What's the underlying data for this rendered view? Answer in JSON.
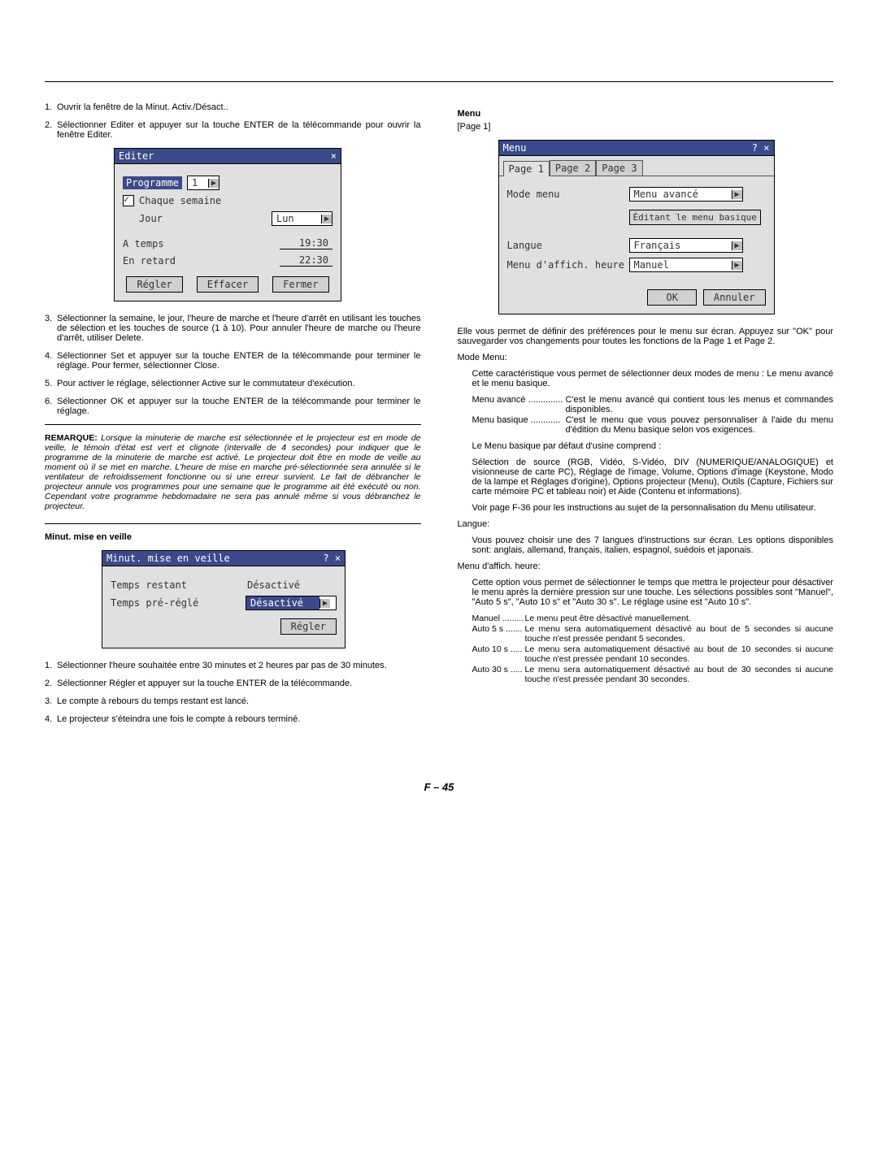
{
  "left": {
    "step1": "Ouvrir la fenêtre de la Minut. Activ./Désact..",
    "step2": "Sélectionner Editer et appuyer sur la touche ENTER de la télécommande pour ouvrir la fenêtre Editer.",
    "editer": {
      "title": "Editer",
      "prog_label": "Programme",
      "prog_val": "1",
      "chaque": "Chaque semaine",
      "jour_label": "Jour",
      "jour_val": "Lun",
      "atemps_label": "A temps",
      "atemps_val": "19:30",
      "retard_label": "En retard",
      "retard_val": "22:30",
      "regler": "Régler",
      "effacer": "Effacer",
      "fermer": "Fermer"
    },
    "step3": "Sélectionner la semaine, le jour, l'heure de marche et l'heure d'arrêt en utilisant les touches de sélection et les touches de source (1 à 10). Pour annuler l'heure de marche ou l'heure d'arrêt, utiliser Delete.",
    "step4": "Sélectionner Set et appuyer sur la touche ENTER de la télécommande pour terminer le réglage. Pour fermer, sélectionner Close.",
    "step5": "Pour activer le réglage, sélectionner Active sur le commutateur d'exécution.",
    "step6": "Sélectionner OK et appuyer sur la touche ENTER de la télécommande pour terminer le réglage.",
    "remark_label": "REMARQUE:",
    "remark": "Lorsque la minuterie de marche est sélectionnée et le projecteur est en mode de veille, le témoin d'état est vert et clignote (intervalle de 4 secondes) pour indiquer que le programme de la minuterie de marche est activé. Le projecteur doit être en mode de veille au moment où il se met en marche. L'heure de mise en marche pré-sélectionnée sera annulée si le ventilateur de refroidissement fonctionne ou si une erreur survient. Le fait de débrancher le projecteur annule vos programmes pour une semaine que le programme ait été exécuté ou non. Cependant votre programme hebdomadaire ne sera pas annulé même si vous débranchez le projecteur.",
    "minut_heading": "Minut. mise en veille",
    "minut": {
      "title": "Minut. mise en veille",
      "temps_restant_label": "Temps restant",
      "temps_restant_val": "Désactivé",
      "preregle_label": "Temps pré-réglé",
      "preregle_val": "Désactivé",
      "regler": "Régler"
    },
    "m1": "Sélectionner l'heure souhaitée entre 30 minutes et 2 heures par pas de 30 minutes.",
    "m2": "Sélectionner Régler et appuyer sur la touche ENTER de la télécommande.",
    "m3": "Le compte à rebours du temps restant est lancé.",
    "m4": "Le projecteur s'éteindra une fois le compte à rebours terminé."
  },
  "right": {
    "menu_heading": "Menu",
    "page1": "[Page 1]",
    "menu": {
      "title": "Menu",
      "tab1": "Page 1",
      "tab2": "Page 2",
      "tab3": "Page 3",
      "mode_label": "Mode menu",
      "mode_val": "Menu avancé",
      "edit_btn": "Éditant le menu basique",
      "langue_label": "Langue",
      "langue_val": "Français",
      "affich_label": "Menu d'affich. heure",
      "affich_val": "Manuel",
      "ok": "OK",
      "annuler": "Annuler"
    },
    "p1": "Elle vous permet de définir des préférences pour le menu sur écran. Appuyez sur \"OK\" pour sauvegarder vos changements pour toutes les fonctions de la Page 1 et Page 2.",
    "mode_heading": "Mode Menu:",
    "mode_desc": "Cette caractéristique vous permet de sélectionner deux modes de menu : Le menu avancé et le menu basique.",
    "def_avance_t": "Menu avancé ..............",
    "def_avance_d": "C'est le menu avancé qui contient tous les menus et commandes disponibles.",
    "def_basique_t": "Menu basique ............",
    "def_basique_d": "C'est le menu que vous pouvez personnaliser à l'aide du menu d'édition du Menu basique selon vos exigences.",
    "defaut": "Le Menu basique par défaut d'usine comprend :",
    "defaut_list": "Sélection de source (RGB, Vidéo, S-Vidéo, DIV (NUMERIQUE/ANALOGIQUE) et visionneuse de carte PC), Réglage de l'image, Volume, Options d'image (Keystone, Modo de la lampe et Réglages d'origine), Options projecteur (Menu), Outils (Capture, Fichiers sur carte mémoire PC et tableau noir) et Aide (Contenu et informations).",
    "voir": "Voir page F-36 pour les instructions au sujet de la personnalisation du Menu utilisateur.",
    "langue_heading": "Langue:",
    "langue_desc": "Vous pouvez choisir une des 7 langues d'instructions sur écran. Les options disponibles sont: anglais, allemand, français, italien, espagnol, suédois et japonais.",
    "affich_heading": "Menu d'affich. heure:",
    "affich_desc": "Cette option vous permet de sélectionner le temps que mettra le projecteur pour désactiver le menu après la dernière pression sur une touche. Les sélections possibles sont \"Manuel\", \"Auto 5 s\", \"Auto 10 s\" et \"Auto 30 s\". Le réglage usine est \"Auto 10 s\".",
    "d_manuel_t": "Manuel .........",
    "d_manuel_d": "Le menu peut être désactivé manuellement.",
    "d_auto5_t": "Auto 5 s .......",
    "d_auto5_d": "Le menu sera automatiquement désactivé au bout de 5 secondes si aucune touche n'est pressée pendant 5 secondes.",
    "d_auto10_t": "Auto 10 s .....",
    "d_auto10_d": "Le menu sera automatiquement désactivé au bout de 10 secondes si aucune touche n'est pressée pendant 10 secondes.",
    "d_auto30_t": "Auto 30 s .....",
    "d_auto30_d": "Le menu sera automatiquement désactivé au bout de 30 secondes si aucune touche n'est pressée pendant 30 secondes."
  },
  "footer": "F – 45"
}
